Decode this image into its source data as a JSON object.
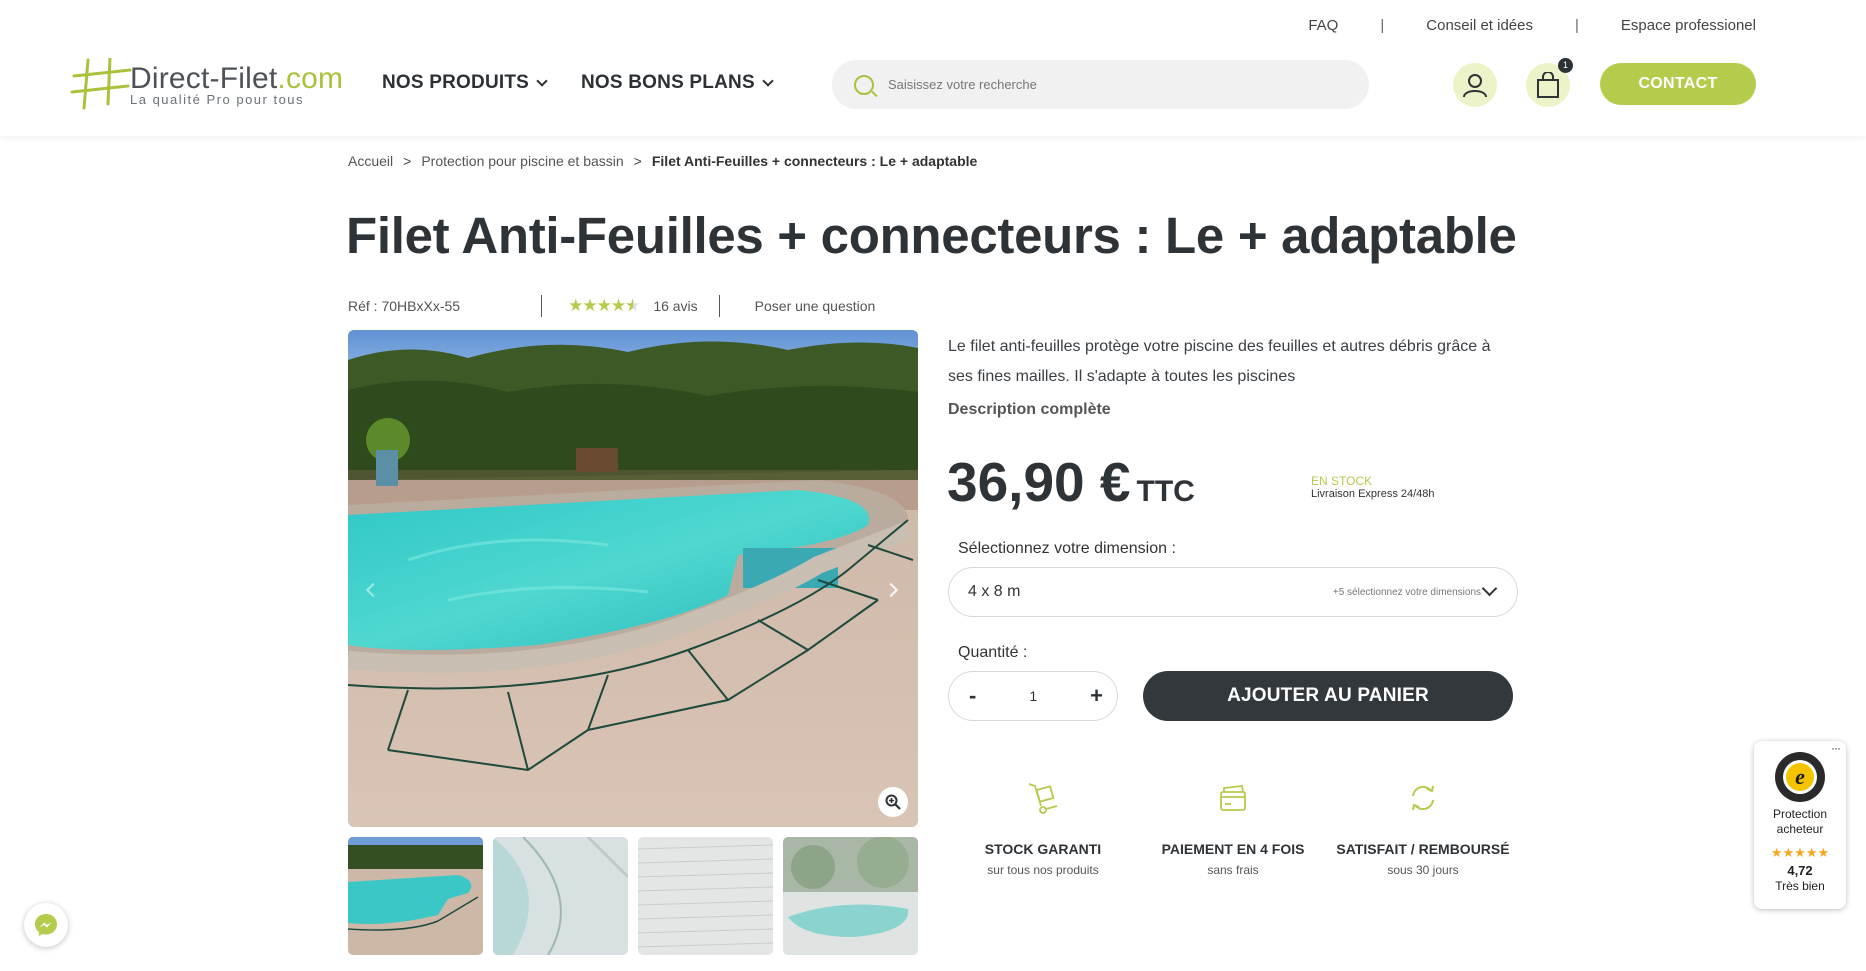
{
  "toplinks": [
    "FAQ",
    "Conseil et idées",
    "Espace professionel"
  ],
  "toplinks_sep": "|",
  "logo": {
    "name_main": "Direct-Filet",
    "name_tld": ".com",
    "tagline": "La qualité Pro pour tous"
  },
  "nav": [
    "NOS PRODUITS",
    "NOS BONS PLANS"
  ],
  "search": {
    "placeholder": "Saisissez votre recherche"
  },
  "cart": {
    "count": "1"
  },
  "contact_label": "CONTACT",
  "breadcrumb": {
    "items": [
      "Accueil",
      "Protection pour piscine et bassin",
      "Filet Anti-Feuilles + connecteurs : Le + adaptable"
    ],
    "sep": ">"
  },
  "product": {
    "title": "Filet Anti-Feuilles + connecteurs : Le + adaptable",
    "ref": "Réf : 70HBxXx-55",
    "rating": 4.5,
    "reviews": "16 avis",
    "question": "Poser une question",
    "description": "Le filet anti-feuilles protège votre piscine des feuilles et autres débris grâce à ses fines mailles. Il s'adapte à toutes les piscines",
    "description_link": "Description complète",
    "price": "36,90 €",
    "price_suffix": "TTC",
    "stock": "EN STOCK",
    "delivery": "Livraison Express 24/48h",
    "dimension_label": "Sélectionnez votre dimension :",
    "dimension_value": "4 x 8 m",
    "dimension_hint": "+5 sélectionnez votre dimensions",
    "quantity_label": "Quantité :",
    "quantity_minus": "-",
    "quantity_value": "1",
    "quantity_plus": "+",
    "add_to_cart": "AJOUTER AU PANIER"
  },
  "features": [
    {
      "icon": "hand-truck-icon",
      "title": "STOCK GARANTI",
      "subtitle": "sur tous nos produits"
    },
    {
      "icon": "credit-card-icon",
      "title": "PAIEMENT EN 4 FOIS",
      "subtitle": "sans frais"
    },
    {
      "icon": "refresh-icon",
      "title": "SATISFAIT / REMBOURSÉ",
      "subtitle": "sous 30 jours"
    }
  ],
  "trusted_shops": {
    "line1": "Protection",
    "line2": "acheteur",
    "score": "4,72",
    "label": "Très bien",
    "menu": "···"
  },
  "colors": {
    "accent": "#b4cc4b",
    "dark": "#33383d",
    "text": "#2e3337",
    "icon_bg": "#edf3c9"
  }
}
